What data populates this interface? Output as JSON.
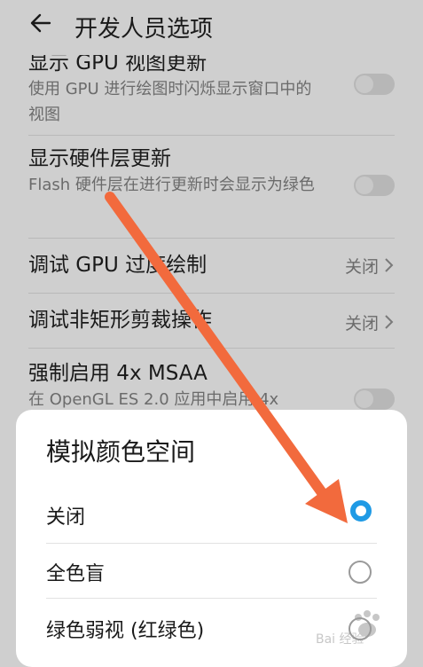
{
  "header": {
    "title": "开发人员选项"
  },
  "settings": [
    {
      "title": "显示 GPU 视图更新",
      "desc": "使用 GPU 进行绘图时闪烁显示窗口中的视图"
    },
    {
      "title": "显示硬件层更新",
      "desc": "Flash 硬件层在进行更新时会显示为绿色"
    },
    {
      "title": "调试 GPU 过度绘制",
      "value": "关闭"
    },
    {
      "title": "调试非矩形剪裁操作",
      "value": "关闭"
    },
    {
      "title": "强制启用 4x MSAA",
      "desc": "在 OpenGL ES 2.0 应用中启用 4x"
    }
  ],
  "dialog": {
    "title": "模拟颜色空间",
    "options": [
      {
        "label": "关闭",
        "selected": true
      },
      {
        "label": "全色盲",
        "selected": false
      },
      {
        "label": "绿色弱视 (红绿色)",
        "selected": false
      }
    ]
  },
  "colors": {
    "accent": "#1f9ae5",
    "arrow": "#f26a3d"
  },
  "watermark": {
    "text": "Bai 经验"
  }
}
